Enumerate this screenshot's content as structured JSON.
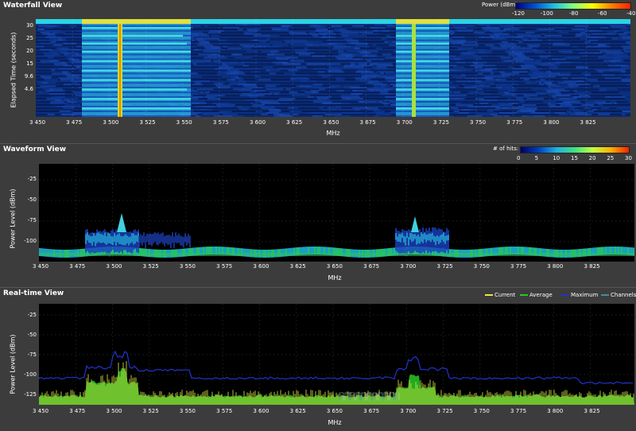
{
  "waterfall": {
    "title": "Waterfall View",
    "power_label": "Power (dBm):",
    "colorbar_ticks": [
      "-120",
      "-100",
      "-80",
      "-60",
      "-40"
    ],
    "ylabel": "Elapsed Time (seconds)",
    "yticks": [
      "30",
      "25",
      "20",
      "15",
      "9.6",
      "4.6"
    ],
    "xlabel": "MHz",
    "xticks": [
      "3 450",
      "3 475",
      "3 500",
      "3 525",
      "3 550",
      "3 575",
      "3 600",
      "3 625",
      "3 650",
      "3 675",
      "3 700",
      "3 725",
      "3 750",
      "3 775",
      "3 800",
      "3 825"
    ]
  },
  "waveform": {
    "title": "Waveform View",
    "hits_label": "# of hits:",
    "colorbar_ticks": [
      "0",
      "5",
      "10",
      "15",
      "20",
      "25",
      "30"
    ],
    "ylabel": "Power Level (dBm)",
    "yticks": [
      "-25",
      "-50",
      "-75",
      "-100"
    ],
    "xlabel": "MHz",
    "xticks": [
      "3 450",
      "3 475",
      "3 500",
      "3 525",
      "3 550",
      "3 575",
      "3 600",
      "3 625",
      "3 650",
      "3 675",
      "3 700",
      "3 725",
      "3 750",
      "3 775",
      "3 800",
      "3 825"
    ]
  },
  "realtime": {
    "title": "Real-time View",
    "legend": [
      {
        "label": "Current",
        "color": "#e8e84a"
      },
      {
        "label": "Average",
        "color": "#22cc22"
      },
      {
        "label": "Maximum",
        "color": "#2233cc"
      },
      {
        "label": "Channels",
        "color": "#4a8a9a"
      }
    ],
    "ylabel": "Power Level (dBm)",
    "yticks": [
      "-25",
      "-50",
      "-75",
      "-100",
      "-125"
    ],
    "xlabel": "MHz",
    "xticks": [
      "3 450",
      "3 475",
      "3 500",
      "3 525",
      "3 550",
      "3 575",
      "3 600",
      "3 625",
      "3 650",
      "3 675",
      "3 700",
      "3 725",
      "3 750",
      "3 775",
      "3 800",
      "3 825"
    ]
  },
  "colors": {
    "bg": "#3c3c3c",
    "plot_bg": "#000000",
    "accent_cyan": "#2ad4e4",
    "accent_green": "#22cc22",
    "accent_yellow": "#e8e84a",
    "accent_blue": "#2233cc"
  }
}
